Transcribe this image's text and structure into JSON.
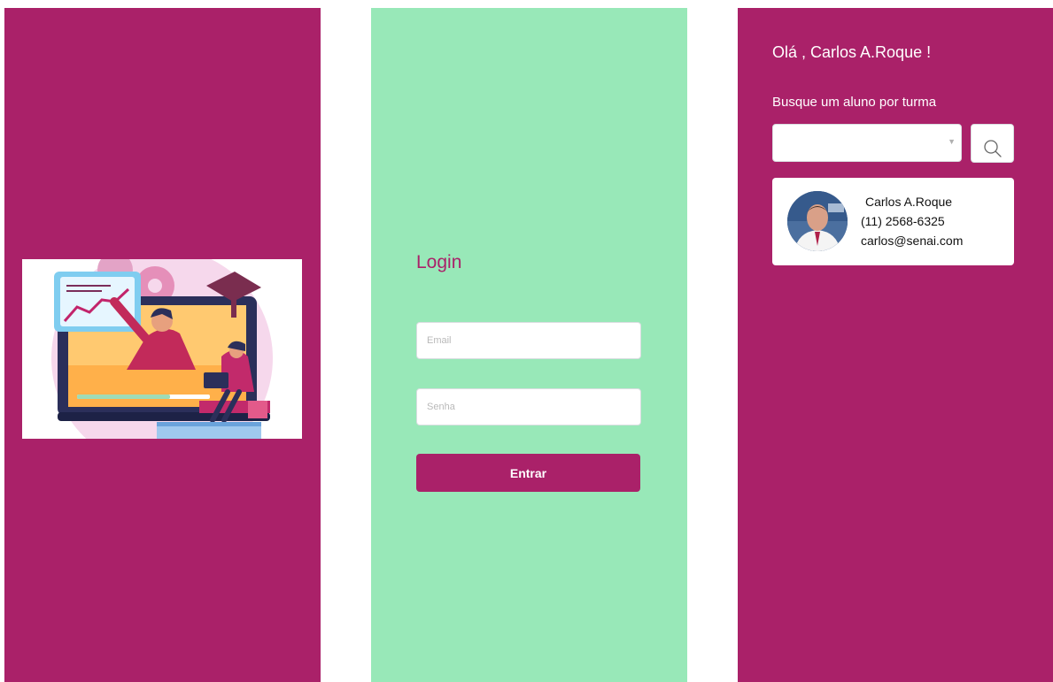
{
  "colors": {
    "brand": "#aa2169",
    "mint": "#98e8b8"
  },
  "splash": {
    "illustration": "online-teaching-illustration"
  },
  "login": {
    "title": "Login",
    "email_placeholder": "Email",
    "password_placeholder": "Senha",
    "submit_label": "Entrar"
  },
  "search": {
    "greeting": "Olá , Carlos A.Roque !",
    "prompt": "Busque um aluno por turma",
    "class_select_value": "",
    "select_arrow": "▼",
    "search_icon": "search-icon",
    "student": {
      "name": "Carlos A.Roque",
      "phone": "(11) 2568-6325",
      "email": "carlos@senai.com"
    }
  }
}
